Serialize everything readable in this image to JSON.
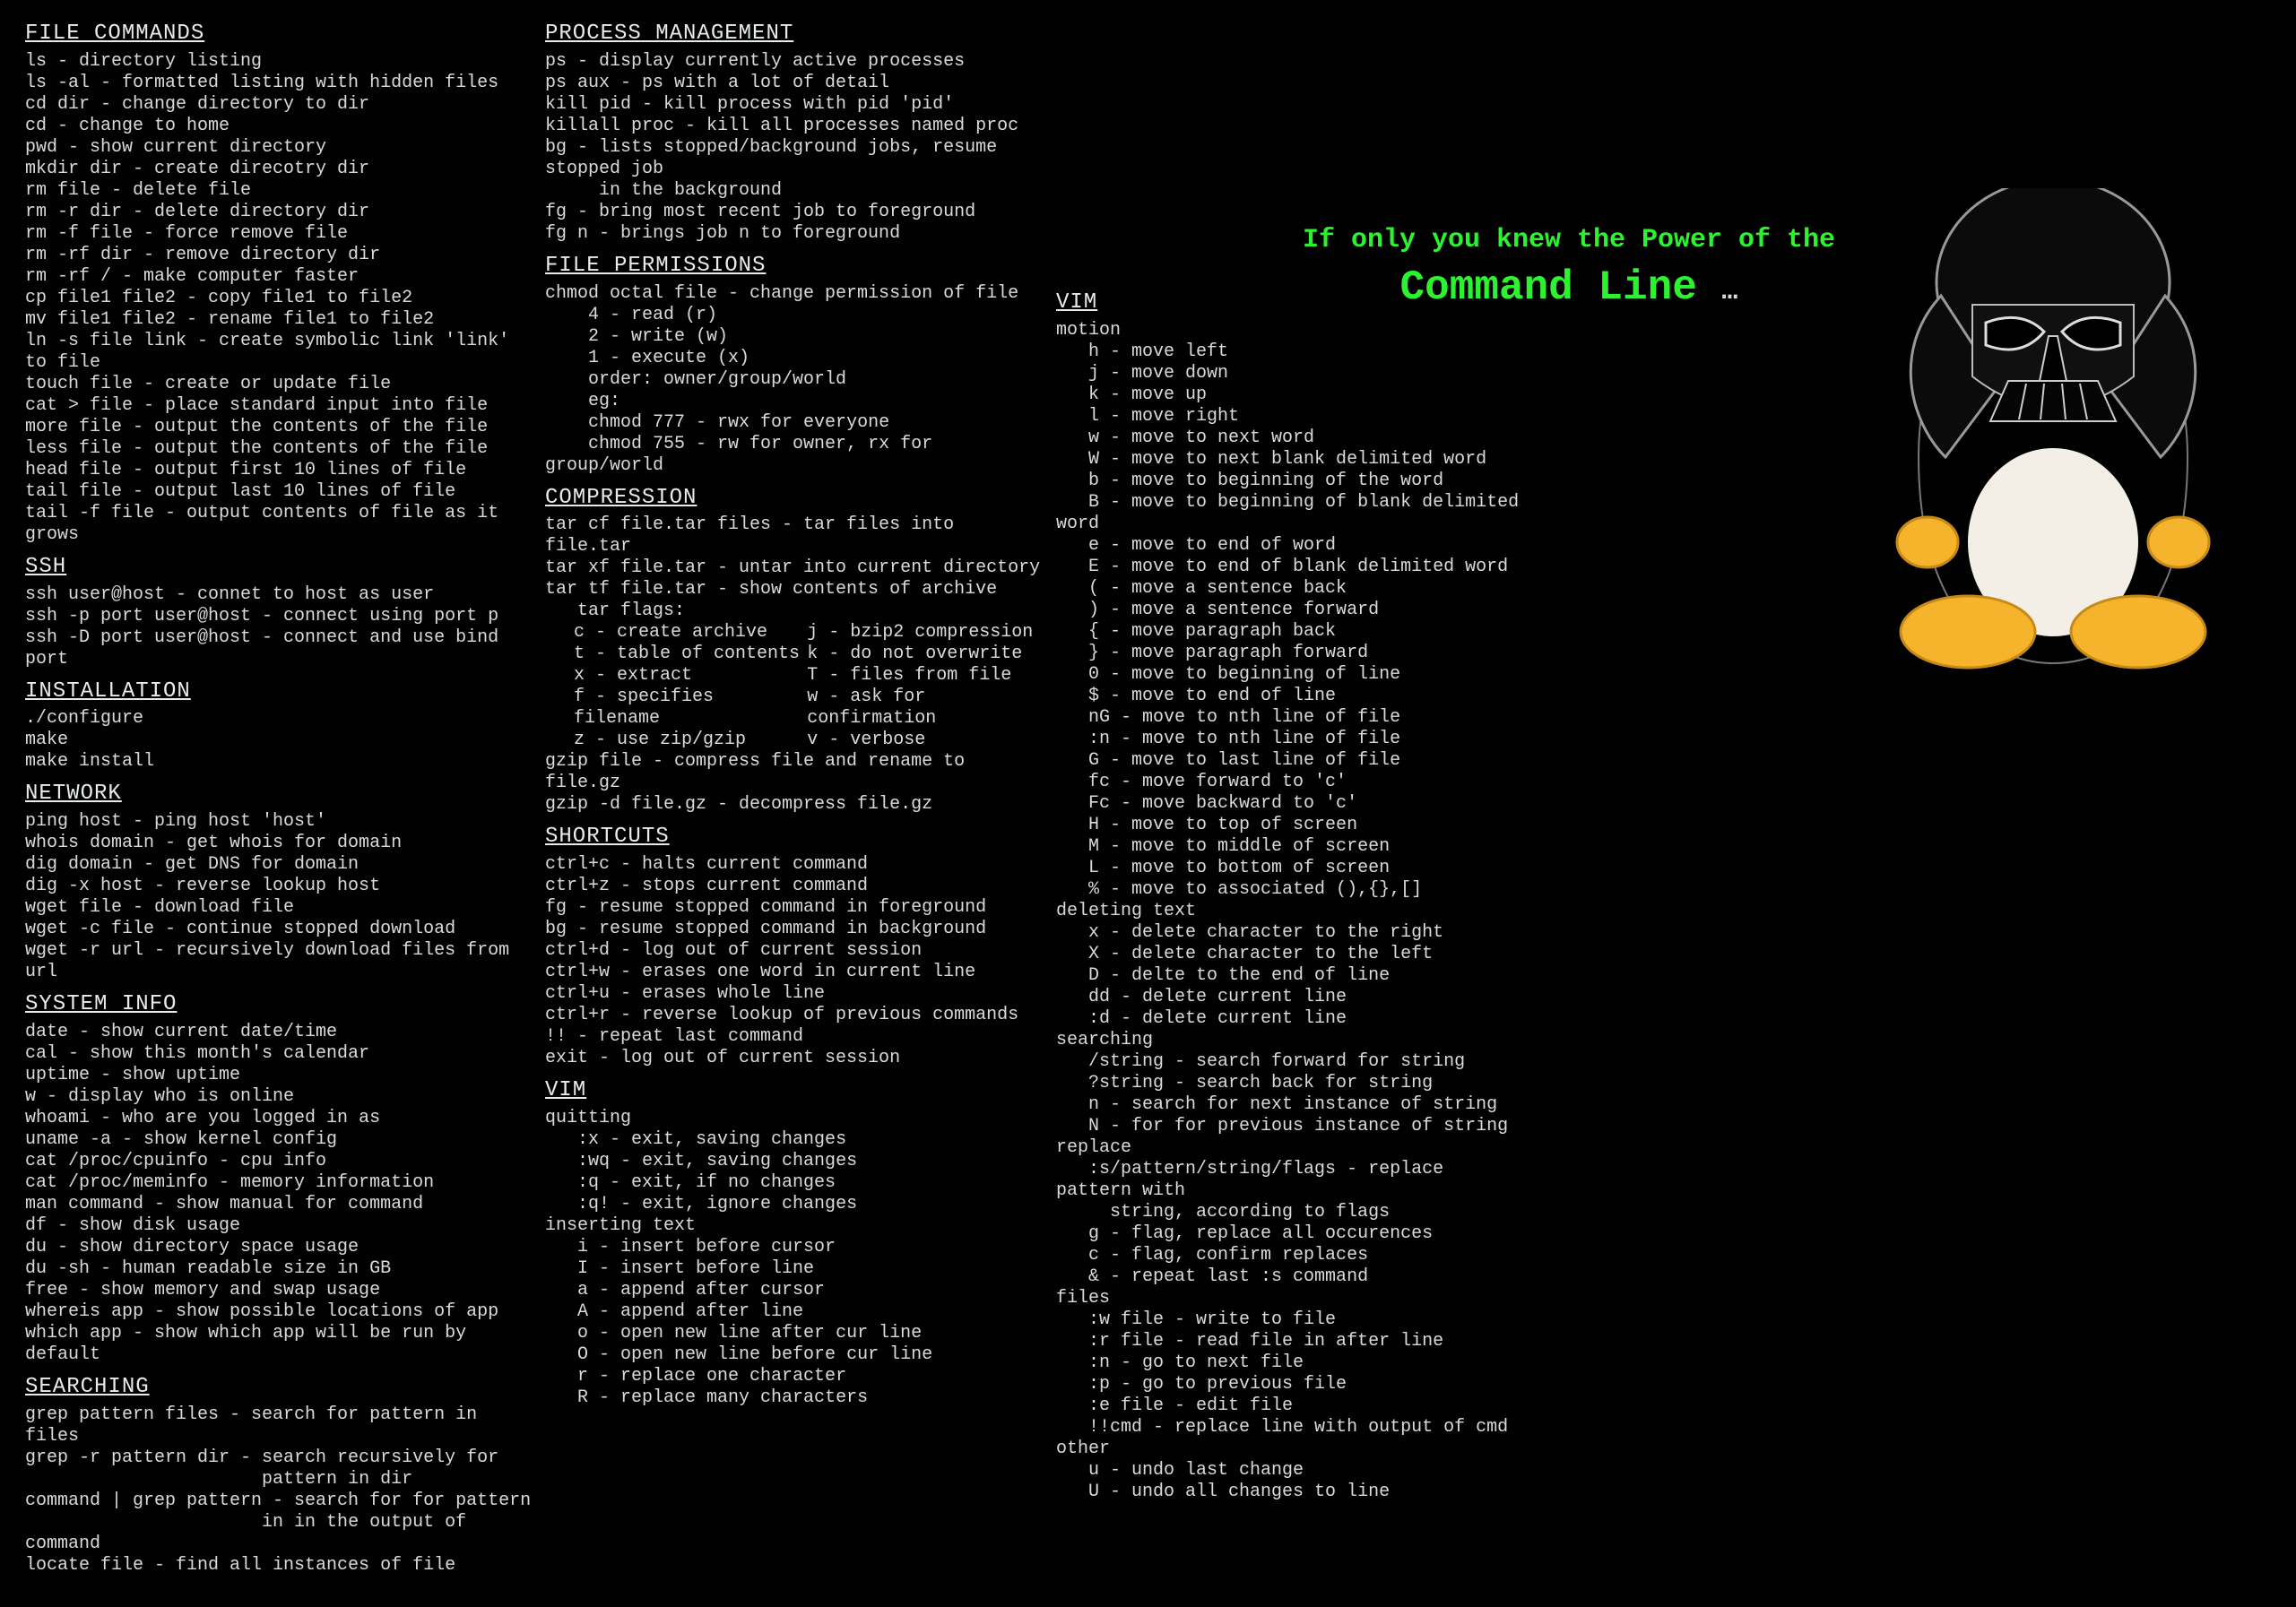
{
  "tagline": {
    "line1": "If only you knew the Power of the",
    "line2": "Command Line",
    "dots": "…"
  },
  "col1": [
    {
      "title": "FILE COMMANDS",
      "lines": [
        "ls - directory listing",
        "ls -al - formatted listing with hidden files",
        "cd dir - change directory to dir",
        "cd - change to home",
        "pwd - show current directory",
        "mkdir dir - create direcotry dir",
        "rm file - delete file",
        "rm -r dir - delete directory dir",
        "rm -f file - force remove file",
        "rm -rf dir - remove directory dir",
        "rm -rf / - make computer faster",
        "cp file1 file2 - copy file1 to file2",
        "mv file1 file2 - rename file1 to file2",
        "ln -s file link - create symbolic link 'link' to file",
        "touch file - create or update file",
        "cat > file - place standard input into file",
        "more file - output the contents of the file",
        "less file - output the contents of the file",
        "head file - output first 10 lines of file",
        "tail file - output last 10 lines of file",
        "tail -f file - output contents of file as it grows"
      ]
    },
    {
      "title": "SSH",
      "lines": [
        "ssh user@host - connet to host as user",
        "ssh -p port user@host - connect using port p",
        "ssh -D port user@host - connect and use bind port"
      ]
    },
    {
      "title": "INSTALLATION",
      "lines": [
        "./configure",
        "make",
        "make install"
      ]
    },
    {
      "title": "NETWORK",
      "lines": [
        "ping host - ping host 'host'",
        "whois domain - get whois for domain",
        "dig domain - get DNS for domain",
        "dig -x host - reverse lookup host",
        "wget file - download file",
        "wget -c file - continue stopped download",
        "wget -r url - recursively download files from url"
      ]
    },
    {
      "title": "SYSTEM INFO",
      "lines": [
        "date - show current date/time",
        "cal - show this month's calendar",
        "uptime - show uptime",
        "w - display who is online",
        "whoami - who are you logged in as",
        "uname -a - show kernel config",
        "cat /proc/cpuinfo - cpu info",
        "cat /proc/meminfo - memory information",
        "man command - show manual for command",
        "df - show disk usage",
        "du - show directory space usage",
        "du -sh - human readable size in GB",
        "free - show memory and swap usage",
        "whereis app - show possible locations of app",
        "which app - show which app will be run by default"
      ]
    },
    {
      "title": "SEARCHING",
      "lines": [
        "grep pattern files - search for pattern in files",
        "grep -r pattern dir - search recursively for",
        "                      pattern in dir",
        "command | grep pattern - search for for pattern",
        "                      in in the output of command",
        "locate file - find all instances of file"
      ]
    }
  ],
  "col2": [
    {
      "title": "PROCESS MANAGEMENT",
      "lines": [
        "ps - display currently active processes",
        "ps aux - ps with a lot of detail",
        "kill pid - kill process with pid 'pid'",
        "killall proc - kill all processes named proc",
        "bg - lists stopped/background jobs, resume stopped job",
        "     in the background",
        "fg - bring most recent job to foreground",
        "fg n - brings job n to foreground"
      ]
    },
    {
      "title": "FILE PERMISSIONS",
      "lines": [
        "chmod octal file - change permission of file",
        "",
        "    4 - read (r)",
        "    2 - write (w)",
        "    1 - execute (x)",
        "",
        "    order: owner/group/world",
        "",
        "    eg:",
        "    chmod 777 - rwx for everyone",
        "    chmod 755 - rw for owner, rx for group/world"
      ]
    },
    {
      "title": "COMPRESSION",
      "lines": [
        "tar cf file.tar files - tar files into file.tar",
        "tar xf file.tar - untar into current directory",
        "tar tf file.tar - show contents of archive",
        "",
        "   tar flags:",
        ""
      ],
      "flags": {
        "a": [
          "c - create archive",
          "t - table of contents",
          "x - extract",
          "f - specifies filename",
          "z - use zip/gzip"
        ],
        "b": [
          "j - bzip2 compression",
          "k - do not overwrite",
          "T - files from file",
          "w - ask for confirmation",
          "v - verbose"
        ]
      },
      "lines2": [
        "",
        "gzip file - compress file and rename to file.gz",
        "gzip -d file.gz - decompress file.gz"
      ]
    },
    {
      "title": "SHORTCUTS",
      "lines": [
        "ctrl+c - halts current command",
        "ctrl+z - stops current command",
        "fg - resume stopped command in foreground",
        "bg - resume stopped command in background",
        "ctrl+d - log out of current session",
        "ctrl+w - erases one word in current line",
        "ctrl+u - erases whole line",
        "ctrl+r - reverse lookup of previous commands",
        "!! - repeat last command",
        "exit - log out of current session"
      ]
    },
    {
      "title": "VIM",
      "lines": [
        "quitting",
        "   :x - exit, saving changes",
        "   :wq - exit, saving changes",
        "   :q - exit, if no changes",
        "   :q! - exit, ignore changes",
        "inserting text",
        "   i - insert before cursor",
        "   I - insert before line",
        "   a - append after cursor",
        "   A - append after line",
        "   o - open new line after cur line",
        "   O - open new line before cur line",
        "   r - replace one character",
        "   R - replace many characters"
      ]
    }
  ],
  "col3": [
    {
      "title": "VIM",
      "pretitle_gap": true,
      "lines": [
        "motion",
        "   h - move left",
        "   j - move down",
        "   k - move up",
        "   l - move right",
        "   w - move to next word",
        "   W - move to next blank delimited word",
        "   b - move to beginning of the word",
        "   B - move to beginning of blank delimited word",
        "   e - move to end of word",
        "   E - move to end of blank delimited word",
        "   ( - move a sentence back",
        "   ) - move a sentence forward",
        "   { - move paragraph back",
        "   } - move paragraph forward",
        "   0 - move to beginning of line",
        "   $ - move to end of line",
        "   nG - move to nth line of file",
        "   :n - move to nth line of file",
        "   G - move to last line of file",
        "   fc - move forward to 'c'",
        "   Fc - move backward to 'c'",
        "   H - move to top of screen",
        "   M - move to middle of screen",
        "   L - move to bottom of screen",
        "   % - move to associated (),{},[]",
        "deleting text",
        "   x - delete character to the right",
        "   X - delete character to the left",
        "   D - delte to the end of line",
        "   dd - delete current line",
        "   :d - delete current line",
        "searching",
        "   /string - search forward for string",
        "   ?string - search back for string",
        "   n - search for next instance of string",
        "   N - for for previous instance of string",
        "replace",
        "   :s/pattern/string/flags - replace pattern with",
        "     string, according to flags",
        "   g - flag, replace all occurences",
        "   c - flag, confirm replaces",
        "   & - repeat last :s command",
        "files",
        "   :w file - write to file",
        "   :r file - read file in after line",
        "   :n - go to next file",
        "   :p - go to previous file",
        "   :e file - edit file",
        "   !!cmd - replace line with output of cmd",
        "other",
        "   u - undo last change",
        "   U - undo all changes to line"
      ]
    }
  ]
}
